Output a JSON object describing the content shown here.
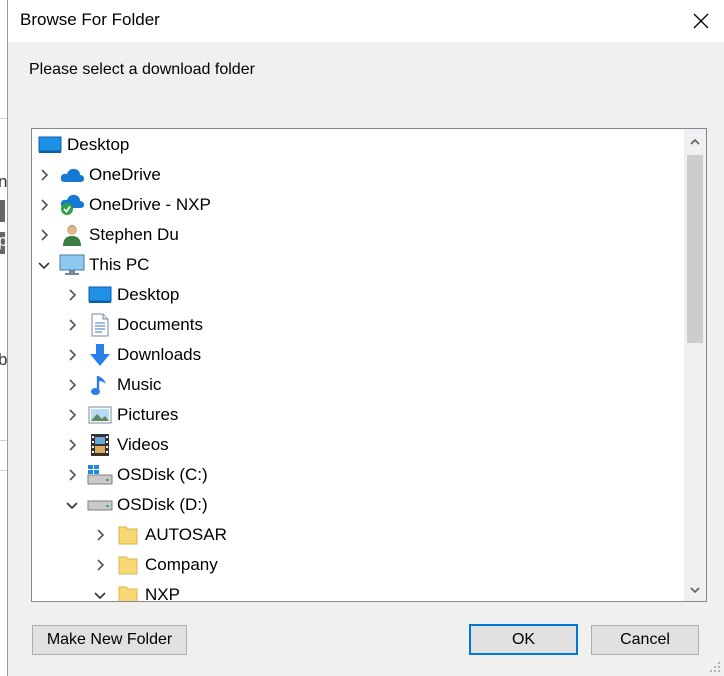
{
  "dialog": {
    "title": "Browse For Folder",
    "prompt": "Please select a download folder"
  },
  "background": {
    "chars": [
      "n",
      "p",
      "b"
    ]
  },
  "tree": {
    "items": [
      {
        "label": "Desktop",
        "icon": "desktop-icon",
        "level": 0,
        "expander": "none"
      },
      {
        "label": "OneDrive",
        "icon": "onedrive-cloud-icon",
        "level": 0,
        "expander": "collapsed"
      },
      {
        "label": "OneDrive - NXP",
        "icon": "onedrive-business-icon",
        "level": 0,
        "expander": "collapsed"
      },
      {
        "label": "Stephen Du",
        "icon": "user-folder-icon",
        "level": 0,
        "expander": "collapsed"
      },
      {
        "label": "This PC",
        "icon": "this-pc-icon",
        "level": 0,
        "expander": "expanded"
      },
      {
        "label": "Desktop",
        "icon": "desktop-icon",
        "level": 1,
        "expander": "collapsed"
      },
      {
        "label": "Documents",
        "icon": "documents-icon",
        "level": 1,
        "expander": "collapsed"
      },
      {
        "label": "Downloads",
        "icon": "downloads-icon",
        "level": 1,
        "expander": "collapsed"
      },
      {
        "label": "Music",
        "icon": "music-icon",
        "level": 1,
        "expander": "collapsed"
      },
      {
        "label": "Pictures",
        "icon": "pictures-icon",
        "level": 1,
        "expander": "collapsed"
      },
      {
        "label": "Videos",
        "icon": "videos-icon",
        "level": 1,
        "expander": "collapsed"
      },
      {
        "label": "OSDisk (C:)",
        "icon": "windows-drive-icon",
        "level": 1,
        "expander": "collapsed"
      },
      {
        "label": "OSDisk (D:)",
        "icon": "drive-icon",
        "level": 1,
        "expander": "expanded"
      },
      {
        "label": "AUTOSAR",
        "icon": "folder-icon",
        "level": 2,
        "expander": "collapsed"
      },
      {
        "label": "Company",
        "icon": "folder-icon",
        "level": 2,
        "expander": "collapsed"
      },
      {
        "label": "NXP",
        "icon": "folder-icon",
        "level": 2,
        "expander": "expanded"
      }
    ]
  },
  "buttons": {
    "make_new_folder": "Make New Folder",
    "ok": "OK",
    "cancel": "Cancel"
  },
  "colors": {
    "accent": "#0078d7",
    "folder": "#f8d775",
    "dialog_bg": "#f0f0f0"
  }
}
